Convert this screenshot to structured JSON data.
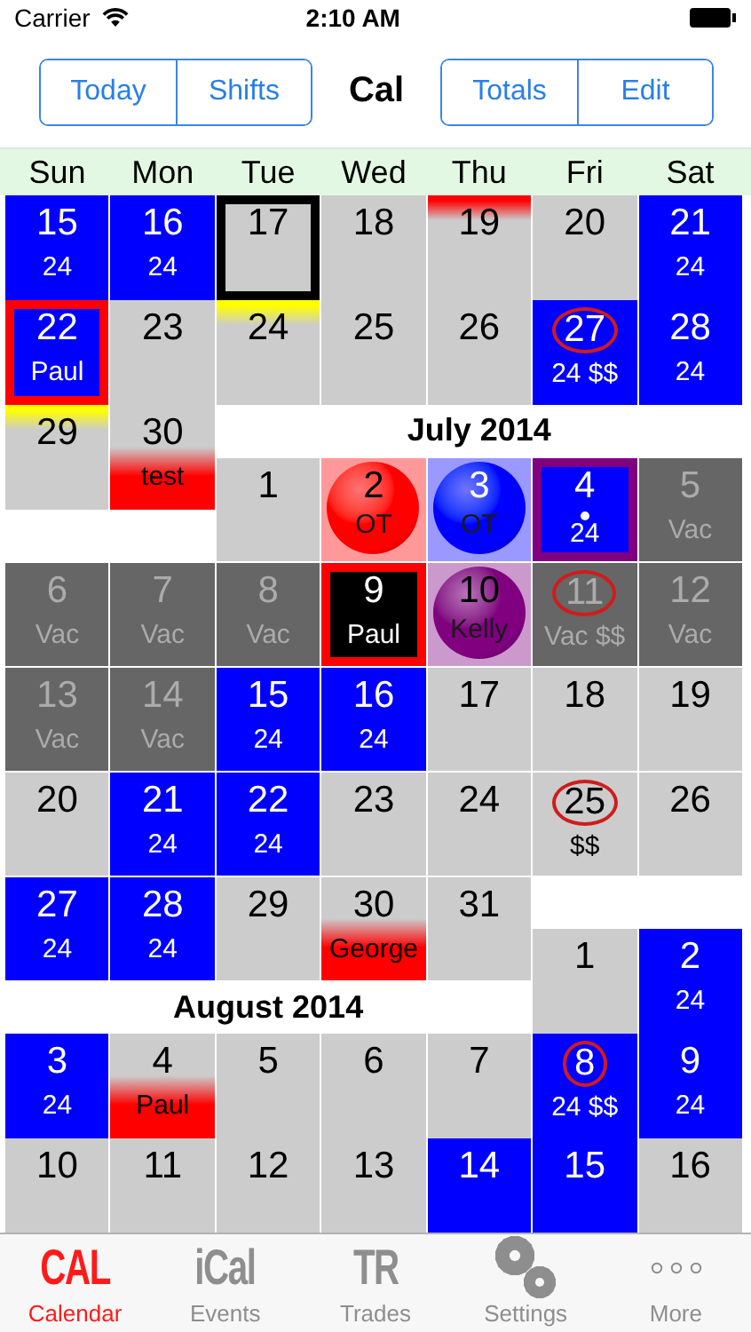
{
  "status_bar": {
    "carrier": "Carrier",
    "time": "2:10 AM"
  },
  "nav_bar": {
    "left_segments": [
      "Today",
      "Shifts"
    ],
    "title": "Cal",
    "right_segments": [
      "Totals",
      "Edit"
    ]
  },
  "weekdays": [
    "Sun",
    "Mon",
    "Tue",
    "Wed",
    "Thu",
    "Fri",
    "Sat"
  ],
  "months": [
    {
      "weeks": [
        [
          {
            "day": "15",
            "label": "24",
            "color": "#0000ff"
          },
          {
            "day": "16",
            "label": "24",
            "color": "#0000ff"
          },
          {
            "day": "17",
            "color": "#cccccc",
            "today": true
          },
          {
            "day": "18",
            "color": "#cccccc"
          },
          {
            "day": "19",
            "color": "#cccccc",
            "stripe": {
              "color": "#ff0000"
            }
          },
          {
            "day": "20",
            "color": "#cccccc"
          },
          {
            "day": "21",
            "label": "24",
            "color": "#0000ff"
          }
        ],
        [
          {
            "day": "22",
            "label": "Paul",
            "color": "#0000ff",
            "border": {
              "color": "#ff0000"
            }
          },
          {
            "day": "23",
            "color": "#cccccc"
          },
          {
            "day": "24",
            "color": "#cccccc",
            "stripe": {
              "color": "#ffff00"
            }
          },
          {
            "day": "25",
            "color": "#cccccc"
          },
          {
            "day": "26",
            "color": "#cccccc"
          },
          {
            "day": "27",
            "label": "24 $$",
            "color": "#0000ff",
            "circled": true
          },
          {
            "day": "28",
            "label": "24",
            "color": "#0000ff"
          }
        ],
        [
          {
            "day": "29",
            "color": "#cccccc",
            "stripe": {
              "color": "#ffff00"
            }
          },
          {
            "day": "30",
            "label": "test",
            "color": "#cccccc",
            "band": {
              "color": "#ff0000"
            }
          }
        ]
      ]
    },
    {
      "title": "July 2014",
      "weeks": [
        [
          {
            "day": "1",
            "color": "#cccccc"
          },
          {
            "day": "2",
            "label": "OT",
            "color": "#ff0000",
            "kind": "ball"
          },
          {
            "day": "3",
            "label": "OT",
            "color": "#0000ff",
            "kind": "ball"
          },
          {
            "day": "4",
            "label": "24",
            "color": "#0000ff",
            "border": {
              "color": "#800080"
            },
            "dot": true
          },
          {
            "day": "5",
            "label": "Vac",
            "color": "#666666"
          }
        ],
        [
          {
            "day": "6",
            "label": "Vac",
            "color": "#666666"
          },
          {
            "day": "7",
            "label": "Vac",
            "color": "#666666"
          },
          {
            "day": "8",
            "label": "Vac",
            "color": "#666666"
          },
          {
            "day": "9",
            "label": "Paul",
            "color": "#000000",
            "border": {
              "color": "#ff0000"
            }
          },
          {
            "day": "10",
            "label": "Kelly",
            "color": "#800080",
            "kind": "ball"
          },
          {
            "day": "11",
            "label": "Vac $$",
            "color": "#666666",
            "circled": true
          },
          {
            "day": "12",
            "label": "Vac",
            "color": "#666666"
          }
        ],
        [
          {
            "day": "13",
            "label": "Vac",
            "color": "#666666"
          },
          {
            "day": "14",
            "label": "Vac",
            "color": "#666666"
          },
          {
            "day": "15",
            "label": "24",
            "color": "#0000ff"
          },
          {
            "day": "16",
            "label": "24",
            "color": "#0000ff"
          },
          {
            "day": "17",
            "color": "#cccccc"
          },
          {
            "day": "18",
            "color": "#cccccc"
          },
          {
            "day": "19",
            "color": "#cccccc"
          }
        ],
        [
          {
            "day": "20",
            "color": "#cccccc"
          },
          {
            "day": "21",
            "label": "24",
            "color": "#0000ff"
          },
          {
            "day": "22",
            "label": "24",
            "color": "#0000ff"
          },
          {
            "day": "23",
            "color": "#cccccc"
          },
          {
            "day": "24",
            "color": "#cccccc"
          },
          {
            "day": "25",
            "label": "$$",
            "color": "#cccccc",
            "circled": true
          },
          {
            "day": "26",
            "color": "#cccccc"
          }
        ],
        [
          {
            "day": "27",
            "label": "24",
            "color": "#0000ff"
          },
          {
            "day": "28",
            "label": "24",
            "color": "#0000ff"
          },
          {
            "day": "29",
            "color": "#cccccc"
          },
          {
            "day": "30",
            "label": "George",
            "color": "#cccccc",
            "band": {
              "color": "#ff0000"
            }
          },
          {
            "day": "31",
            "color": "#cccccc"
          }
        ]
      ]
    },
    {
      "title": "August 2014",
      "weeks": [
        [
          {
            "day": "1",
            "color": "#cccccc"
          },
          {
            "day": "2",
            "label": "24",
            "color": "#0000ff"
          }
        ],
        [
          {
            "day": "3",
            "label": "24",
            "color": "#0000ff"
          },
          {
            "day": "4",
            "label": "Paul",
            "color": "#cccccc",
            "band": {
              "color": "#ff0000"
            }
          },
          {
            "day": "5",
            "color": "#cccccc"
          },
          {
            "day": "6",
            "color": "#cccccc"
          },
          {
            "day": "7",
            "color": "#cccccc"
          },
          {
            "day": "8",
            "label": "24 $$",
            "color": "#0000ff",
            "circled": true
          },
          {
            "day": "9",
            "label": "24",
            "color": "#0000ff"
          }
        ],
        [
          {
            "day": "10",
            "color": "#cccccc"
          },
          {
            "day": "11",
            "color": "#cccccc"
          },
          {
            "day": "12",
            "color": "#cccccc"
          },
          {
            "day": "13",
            "color": "#cccccc"
          },
          {
            "day": "14",
            "color": "#0000ff"
          },
          {
            "day": "15",
            "color": "#0000ff"
          },
          {
            "day": "16",
            "color": "#cccccc"
          }
        ]
      ]
    }
  ],
  "tab_bar": [
    {
      "kind": "text",
      "glyph": "CAL",
      "label": "Calendar",
      "selected": true
    },
    {
      "kind": "text",
      "glyph": "iCal",
      "label": "Events",
      "selected": false
    },
    {
      "kind": "text",
      "glyph": "TR",
      "label": "Trades",
      "selected": false
    },
    {
      "kind": "gears",
      "label": "Settings",
      "selected": false
    },
    {
      "kind": "dots",
      "label": "More",
      "selected": false
    }
  ]
}
